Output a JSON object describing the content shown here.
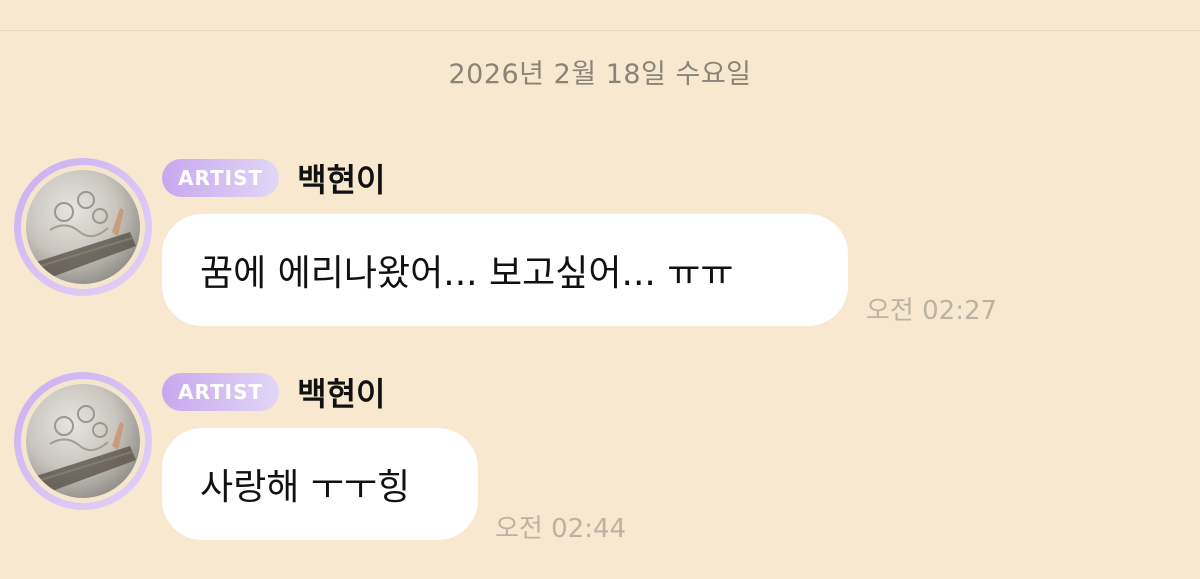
{
  "date_header": "2026년 2월 18일 수요일",
  "messages": [
    {
      "badge": "ARTIST",
      "sender": "백현이",
      "text": "꿈에 에리나왔어... 보고싶어... ㅠㅠ",
      "time": "오전 02:27"
    },
    {
      "badge": "ARTIST",
      "sender": "백현이",
      "text": "사랑해 ㅜㅜ힝",
      "time": "오전 02:44"
    }
  ],
  "colors": {
    "background": "#f7e8cf",
    "bubble": "#ffffff",
    "badge_gradient_start": "#c7a8ef",
    "badge_gradient_end": "#e1d6f6",
    "timestamp": "#bcb2a3",
    "date_header": "#8a8378"
  },
  "icons": {
    "avatar": "snow-photo-avatar"
  }
}
